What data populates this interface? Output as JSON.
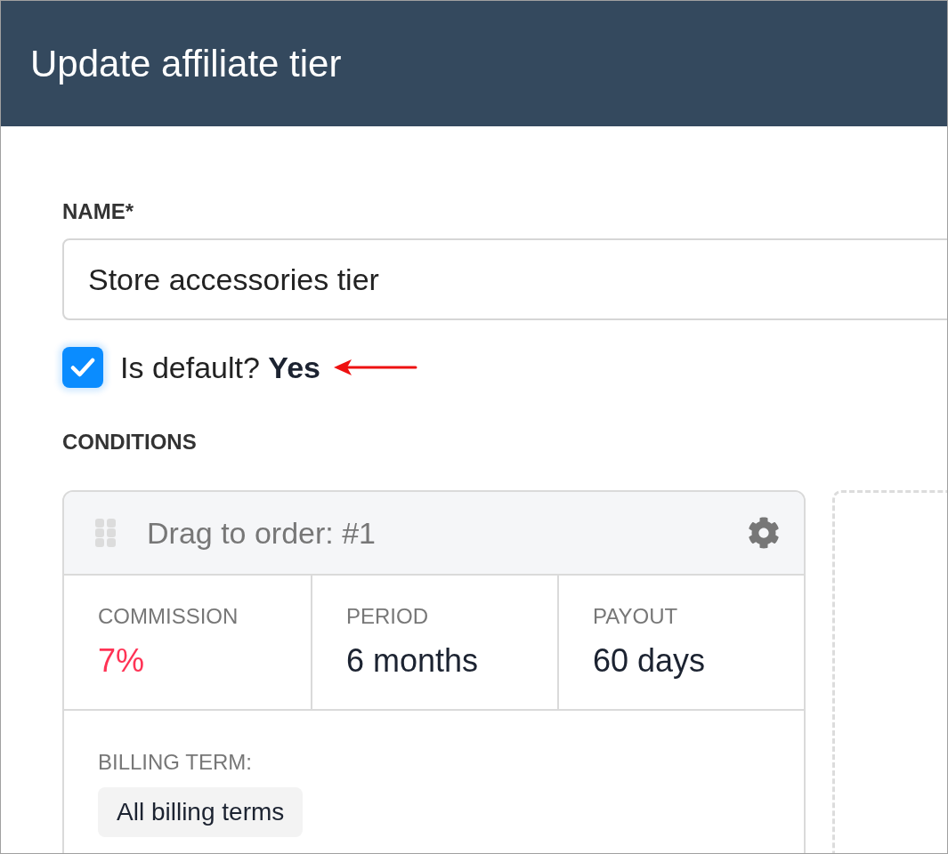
{
  "header": {
    "title": "Update affiliate tier"
  },
  "name_field": {
    "label": "NAME*",
    "value": "Store accessories tier"
  },
  "default_checkbox": {
    "label": "Is default? **Yes**",
    "checked": true
  },
  "conditions": {
    "heading": "CONDITIONS",
    "cards": [
      {
        "drag_label": "Drag to order: #1",
        "stats": [
          {
            "label": "COMMISSION",
            "value": "7%",
            "highlight": true
          },
          {
            "label": "PERIOD",
            "value": "6 months",
            "highlight": false
          },
          {
            "label": "PAYOUT",
            "value": "60 days",
            "highlight": false
          }
        ],
        "billing": {
          "label": "BILLING TERM:",
          "terms": [
            "All billing terms"
          ]
        }
      }
    ]
  }
}
